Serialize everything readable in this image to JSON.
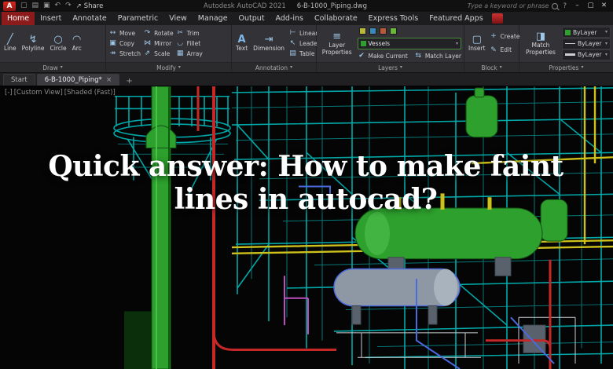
{
  "titlebar": {
    "logo": "A",
    "share": "Share",
    "app_title": "Autodesk AutoCAD 2021",
    "doc_name": "6-B-1000_Piping.dwg",
    "search_placeholder": "Type a keyword or phrase"
  },
  "icons": {
    "caret_down": "▾",
    "new_file": "▢",
    "open_file": "▤",
    "save": "▣",
    "undo": "↶",
    "redo": "↷",
    "share_arrow": "↗",
    "help": "?",
    "minimize": "–",
    "maximize": "▢",
    "close": "✕",
    "tab_close": "×",
    "tab_new": "+",
    "line": "╱",
    "polyline": "↯",
    "circle": "○",
    "arc": "◠",
    "move": "↔",
    "copy": "▣",
    "stretch": "↠",
    "rotate": "↷",
    "mirror": "⋈",
    "scale": "⇗",
    "trim": "✂",
    "fillet": "◡",
    "array": "▦",
    "text": "A",
    "dimension": "⇥",
    "linear": "⊢",
    "leader": "↖",
    "table": "▤",
    "layer_properties": "≡",
    "make_current": "✔",
    "match_layer": "⇆",
    "insert_block": "▢",
    "create_block": "+",
    "edit_block": "✎",
    "match_properties": "◨"
  },
  "ribbon": {
    "tabs": [
      "Home",
      "Insert",
      "Annotate",
      "Parametric",
      "View",
      "Manage",
      "Output",
      "Add-ins",
      "Collaborate",
      "Express Tools",
      "Featured Apps"
    ]
  },
  "panels": {
    "draw": {
      "label": "Draw",
      "tools": [
        "Line",
        "Polyline",
        "Circle",
        "Arc"
      ]
    },
    "modify": {
      "label": "Modify",
      "tools": [
        "Move",
        "Copy",
        "Stretch",
        "Rotate",
        "Mirror",
        "Scale",
        "Trim",
        "Fillet",
        "Array"
      ]
    },
    "annotation": {
      "label": "Annotation",
      "tools": [
        "Text",
        "Dimension",
        "Linear",
        "Leader",
        "Table"
      ]
    },
    "layers": {
      "label": "Layers",
      "layer_properties": "Layer Properties",
      "current_layer": "Vessels",
      "make_current": "Make Current",
      "match_layer": "Match Layer"
    },
    "block": {
      "label": "Block",
      "tools": [
        "Insert",
        "Create",
        "Edit"
      ]
    },
    "properties": {
      "label": "Properties",
      "match_properties": "Match Properties",
      "values": [
        "ByLayer",
        "ByLayer",
        "ByLayer"
      ]
    }
  },
  "doc_tabs": {
    "start": "Start",
    "drawing": "6-B-1000_Piping*"
  },
  "viewport": {
    "controls": "[-]",
    "view_name": "[Custom View]",
    "visual_style": "[Shaded (Fast)]"
  },
  "overlay": {
    "title": "Quick answer: How to make faint lines in autocad?"
  },
  "colors": {
    "teal": "#00a9a9",
    "teal2": "#067878",
    "green": "#2da02d",
    "green_dark": "#115111",
    "red": "#c62828",
    "yellow": "#cfc11c",
    "blue": "#4a6add",
    "magenta": "#bb4fbb",
    "steel": "#8d98a4",
    "steel_dark": "#5c6670"
  }
}
